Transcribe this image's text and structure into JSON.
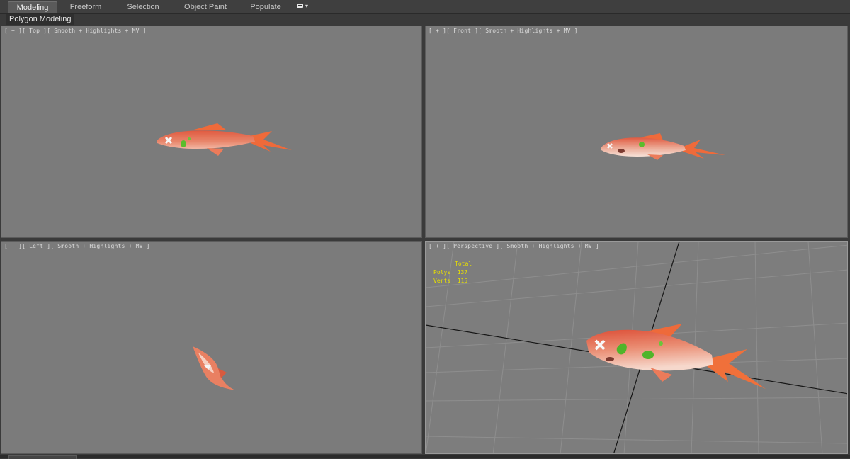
{
  "ribbon": {
    "tabs": [
      {
        "label": "Modeling",
        "active": true
      },
      {
        "label": "Freeform",
        "active": false
      },
      {
        "label": "Selection",
        "active": false
      },
      {
        "label": "Object Paint",
        "active": false
      },
      {
        "label": "Populate",
        "active": false
      }
    ],
    "panel_label": "Polygon Modeling"
  },
  "viewports": {
    "top": {
      "label": "[ + ][ Top ][ Smooth + Highlights + MV ]"
    },
    "front": {
      "label": "[ + ][ Front ][ Smooth + Highlights + MV ]"
    },
    "left": {
      "label": "[ + ][ Left ][ Smooth + Highlights + MV ]"
    },
    "perspective": {
      "label": "[ + ][ Perspective ][ Smooth + Highlights + MV ]",
      "stats": {
        "header": "Total",
        "polys_label": "Polys",
        "polys_value": "137",
        "verts_label": "Verts",
        "verts_value": "115"
      }
    }
  },
  "colors": {
    "viewport_bg": "#7b7b7b",
    "fish_body": "#e8735a",
    "fish_fin": "#f0703a",
    "stats_text": "#e8e000",
    "grid_line": "#8e8e8e"
  },
  "icons": [
    "fish-model",
    "viewport-toggle-icon"
  ]
}
